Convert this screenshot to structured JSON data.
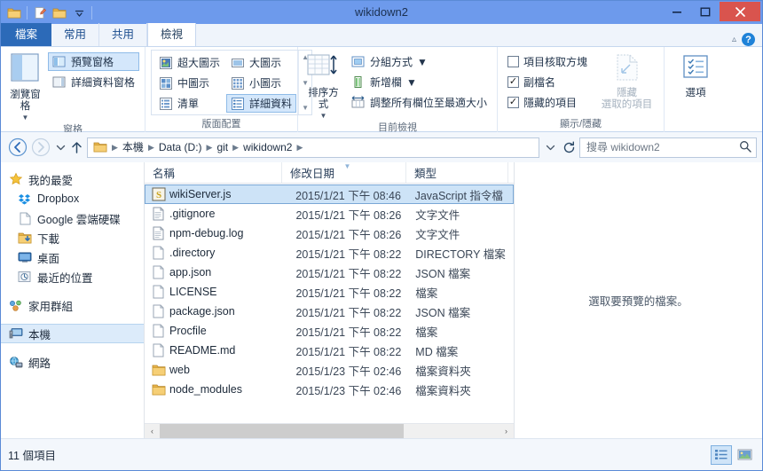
{
  "window": {
    "title": "wikidown2",
    "controls": {
      "minimize": "–",
      "maximize": "☐",
      "close": "✕"
    },
    "quick_access": [
      "folder-icon",
      "new-folder-properties-icon",
      "folder-icon",
      "chevron-down-icon"
    ]
  },
  "ribbon": {
    "tabs": [
      {
        "label": "檔案",
        "id": "file",
        "state": "file"
      },
      {
        "label": "常用",
        "id": "home",
        "state": "normal"
      },
      {
        "label": "共用",
        "id": "share",
        "state": "normal"
      },
      {
        "label": "檢視",
        "id": "view",
        "state": "active"
      }
    ],
    "help_label": "?",
    "groups": [
      {
        "title": "窗格",
        "big_button": {
          "label": "瀏覽窗格"
        },
        "items": [
          {
            "label": "預覽窗格",
            "selected": true
          },
          {
            "label": "詳細資料窗格",
            "selected": false
          }
        ]
      },
      {
        "title": "版面配置",
        "gallery": [
          {
            "label": "超大圖示",
            "selected": false
          },
          {
            "label": "大圖示",
            "selected": false
          },
          {
            "label": "中圖示",
            "selected": false
          },
          {
            "label": "小圖示",
            "selected": false
          },
          {
            "label": "清單",
            "selected": false
          },
          {
            "label": "詳細資料",
            "selected": true
          }
        ]
      },
      {
        "title": "目前檢視",
        "big_button": {
          "label": "排序方式"
        },
        "items": [
          {
            "label": "分組方式",
            "dropdown": true
          },
          {
            "label": "新增欄",
            "dropdown": true
          },
          {
            "label": "調整所有欄位至最適大小",
            "dropdown": false
          }
        ]
      },
      {
        "title": "顯示/隱藏",
        "checkboxes": [
          {
            "label": "項目核取方塊",
            "checked": false
          },
          {
            "label": "副檔名",
            "checked": true
          },
          {
            "label": "隱藏的項目",
            "checked": true
          }
        ],
        "hide_button": {
          "line1": "隱藏",
          "line2": "選取的項目",
          "disabled": true
        }
      },
      {
        "title": "",
        "options_button": {
          "label": "選項"
        }
      }
    ]
  },
  "navbar": {
    "back": "←",
    "forward": "→",
    "recent": "▾",
    "up": "↑",
    "breadcrumbs": [
      "本機",
      "Data (D:)",
      "git",
      "wikidown2"
    ],
    "dropdown": "⌄",
    "refresh": "↻",
    "search_placeholder": "搜尋 wikidown2",
    "search_value": ""
  },
  "sidebar": {
    "sections": [
      {
        "header": {
          "label": "我的最愛",
          "icon": "star-icon"
        },
        "items": [
          {
            "label": "Dropbox",
            "icon": "dropbox-icon"
          },
          {
            "label": "Google 雲端硬碟",
            "icon": "document-icon"
          },
          {
            "label": "下載",
            "icon": "downloads-icon"
          },
          {
            "label": "桌面",
            "icon": "desktop-icon"
          },
          {
            "label": "最近的位置",
            "icon": "recent-icon"
          }
        ]
      },
      {
        "header": {
          "label": "家用群組",
          "icon": "homegroup-icon"
        },
        "items": []
      },
      {
        "header": {
          "label": "本機",
          "icon": "computer-icon",
          "selected": true
        },
        "items": []
      },
      {
        "header": {
          "label": "網路",
          "icon": "network-icon"
        },
        "items": []
      }
    ]
  },
  "filelist": {
    "columns": [
      {
        "label": "名稱",
        "sort": null
      },
      {
        "label": "修改日期",
        "sort": "desc"
      },
      {
        "label": "類型",
        "sort": null
      }
    ],
    "rows": [
      {
        "name": "wikiServer.js",
        "date": "2015/1/21 下午 08:46",
        "type": "JavaScript 指令檔",
        "icon": "js-file-icon",
        "selected": true
      },
      {
        "name": ".gitignore",
        "date": "2015/1/21 下午 08:26",
        "type": "文字文件",
        "icon": "text-file-icon",
        "selected": false
      },
      {
        "name": "npm-debug.log",
        "date": "2015/1/21 下午 08:26",
        "type": "文字文件",
        "icon": "text-file-icon",
        "selected": false
      },
      {
        "name": ".directory",
        "date": "2015/1/21 下午 08:22",
        "type": "DIRECTORY 檔案",
        "icon": "blank-file-icon",
        "selected": false
      },
      {
        "name": "app.json",
        "date": "2015/1/21 下午 08:22",
        "type": "JSON 檔案",
        "icon": "blank-file-icon",
        "selected": false
      },
      {
        "name": "LICENSE",
        "date": "2015/1/21 下午 08:22",
        "type": "檔案",
        "icon": "blank-file-icon",
        "selected": false
      },
      {
        "name": "package.json",
        "date": "2015/1/21 下午 08:22",
        "type": "JSON 檔案",
        "icon": "blank-file-icon",
        "selected": false
      },
      {
        "name": "Procfile",
        "date": "2015/1/21 下午 08:22",
        "type": "檔案",
        "icon": "blank-file-icon",
        "selected": false
      },
      {
        "name": "README.md",
        "date": "2015/1/21 下午 08:22",
        "type": "MD 檔案",
        "icon": "blank-file-icon",
        "selected": false
      },
      {
        "name": "web",
        "date": "2015/1/23 下午 02:46",
        "type": "檔案資料夾",
        "icon": "folder-icon",
        "selected": false
      },
      {
        "name": "node_modules",
        "date": "2015/1/23 下午 02:46",
        "type": "檔案資料夾",
        "icon": "folder-icon",
        "selected": false
      }
    ],
    "scroll_left": "‹",
    "scroll_right": "›"
  },
  "preview": {
    "empty_text": "選取要預覽的檔案。"
  },
  "statusbar": {
    "item_count": "11 個項目",
    "view_details": "details-view-icon",
    "view_thumbnails": "large-icons-view-icon"
  },
  "colors": {
    "titlebar": "#6d9aec",
    "accent": "#2c6ab8",
    "close": "#d9544e",
    "selection": "#cde3f7",
    "folder": "#f2c14e"
  }
}
